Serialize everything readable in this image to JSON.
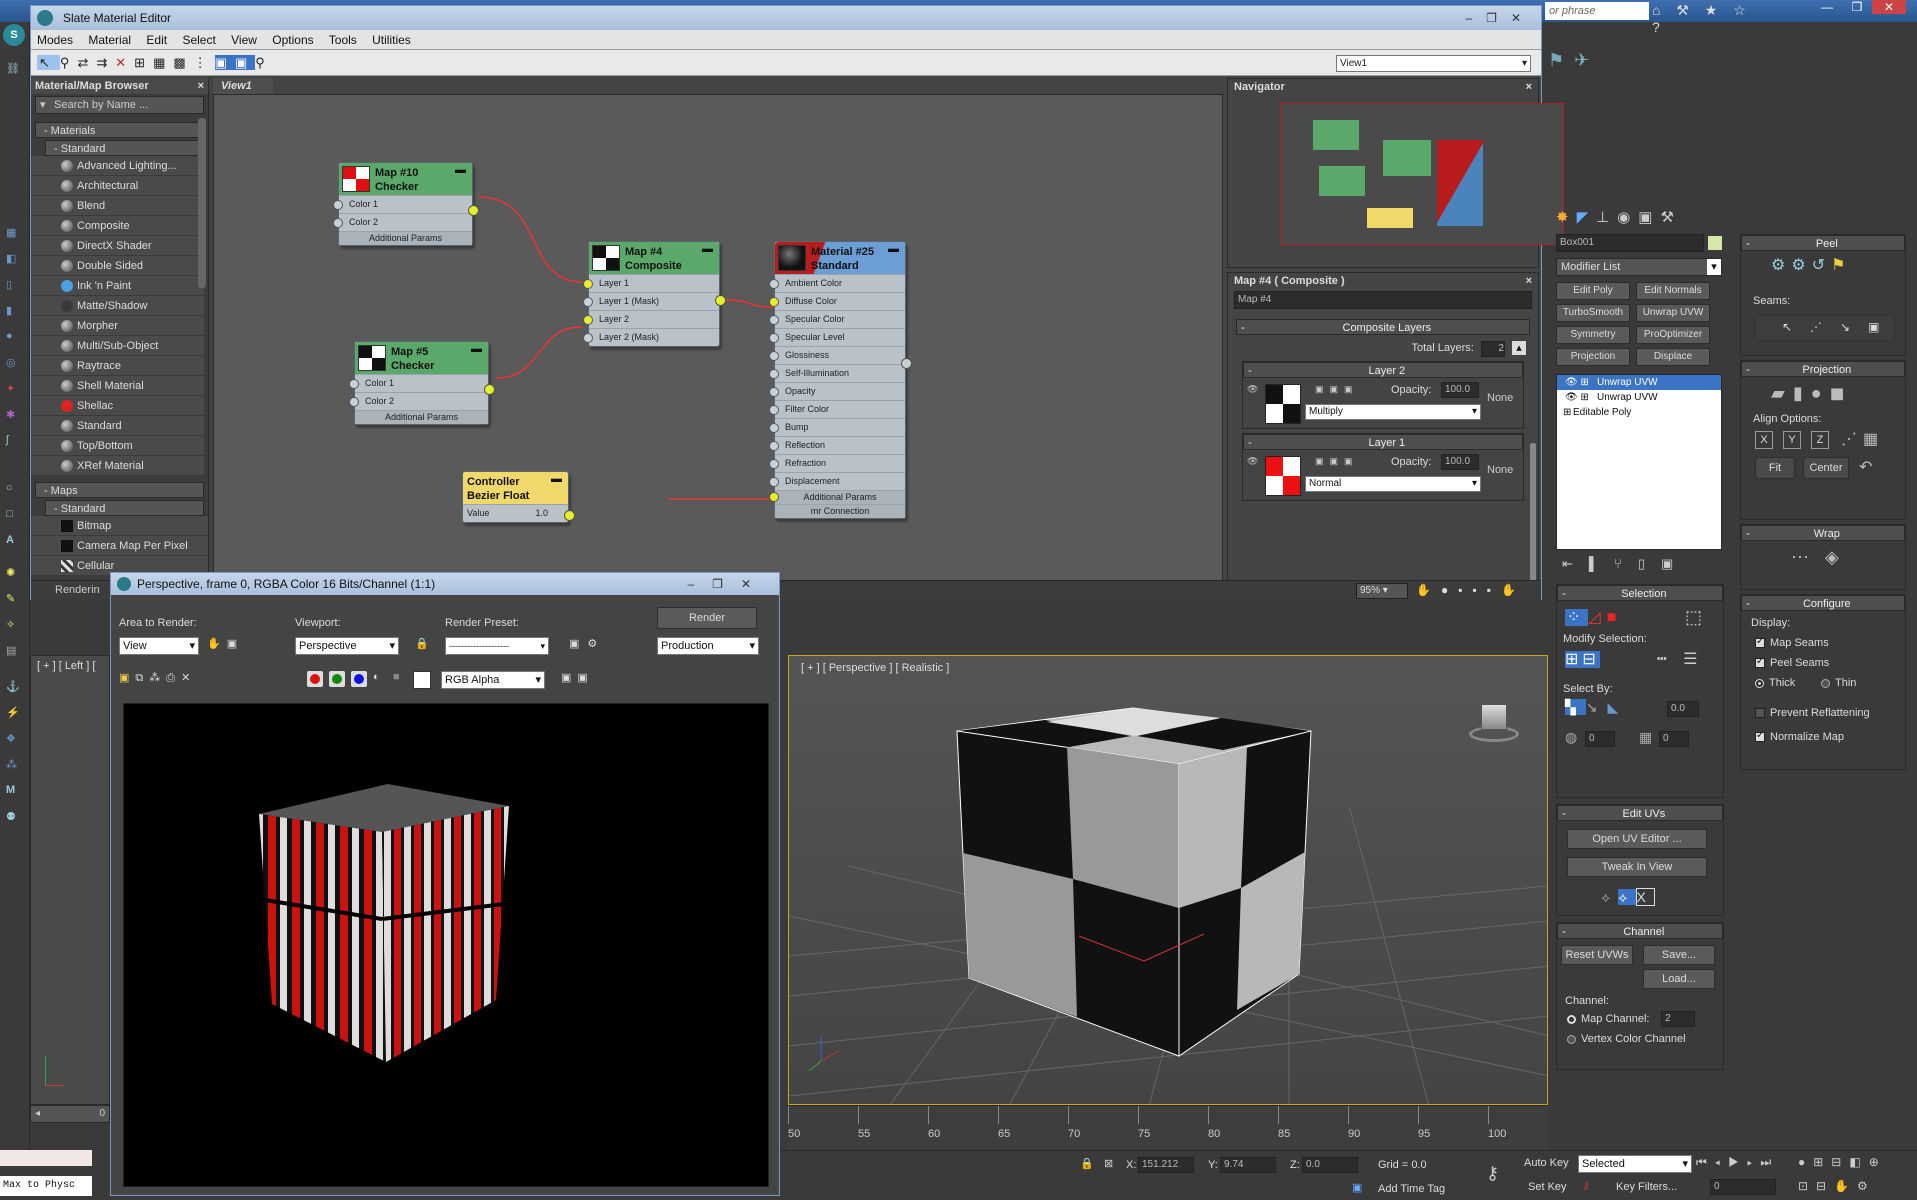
{
  "app": {
    "slate_title": "Slate Material Editor",
    "search_top_placeholder": "or phrase"
  },
  "slate_menu": [
    "Modes",
    "Material",
    "Edit",
    "Select",
    "View",
    "Options",
    "Tools",
    "Utilities"
  ],
  "view_dropdown": "View1",
  "browser": {
    "title": "Material/Map Browser",
    "search_placeholder": "Search by Name ...",
    "materials_label": "Materials",
    "standard_label": "Standard",
    "materials": [
      "Advanced Lighting...",
      "Architectural",
      "Blend",
      "Composite",
      "DirectX Shader",
      "Double Sided",
      "Ink 'n Paint",
      "Matte/Shadow",
      "Morpher",
      "Multi/Sub-Object",
      "Raytrace",
      "Shell Material",
      "Shellac",
      "Standard",
      "Top/Bottom",
      "XRef Material"
    ],
    "maps_label": "Maps",
    "maps_standard_label": "Standard",
    "maps": [
      "Bitmap",
      "Camera Map Per Pixel",
      "Cellular"
    ]
  },
  "view_tab": "View1",
  "nodes": {
    "map10": {
      "line1": "Map #10",
      "line2": "Checker",
      "slots": [
        "Color 1",
        "Color 2"
      ],
      "addp": "Additional Params"
    },
    "map5": {
      "line1": "Map #5",
      "line2": "Checker",
      "slots": [
        "Color 1",
        "Color 2"
      ],
      "addp": "Additional Params"
    },
    "map4": {
      "line1": "Map #4",
      "line2": "Composite",
      "slots": [
        "Layer 1",
        "Layer 1 (Mask)",
        "Layer 2",
        "Layer 2 (Mask)"
      ]
    },
    "mat25": {
      "line1": "Material #25",
      "line2": "Standard",
      "slots": [
        "Ambient Color",
        "Diffuse Color",
        "Specular Color",
        "Specular Level",
        "Glossiness",
        "Self-Illumination",
        "Opacity",
        "Filter Color",
        "Bump",
        "Reflection",
        "Refraction",
        "Displacement"
      ],
      "addp": "Additional Params",
      "mr": "mr Connection"
    },
    "ctrl": {
      "line1": "Controller",
      "line2": "Bezier Float",
      "slot": "Value",
      "value": "1.0"
    }
  },
  "navigator": {
    "title": "Navigator"
  },
  "composite_panel": {
    "title": "Map #4  ( Composite )",
    "name_field": "Map #4",
    "rollout": "Composite Layers",
    "total_layers_label": "Total Layers:",
    "total_layers": "2",
    "layer2": {
      "title": "Layer 2",
      "opacity_label": "Opacity:",
      "opacity": "100.0",
      "mode": "Multiply",
      "none": "None"
    },
    "layer1": {
      "title": "Layer 1",
      "opacity_label": "Opacity:",
      "opacity": "100.0",
      "mode": "Normal",
      "none": "None"
    }
  },
  "zoom": "95%",
  "render_window": {
    "title": "Perspective, frame 0, RGBA Color 16 Bits/Channel (1:1)",
    "area_label": "Area to Render:",
    "area_value": "View",
    "viewport_label": "Viewport:",
    "viewport_value": "Perspective",
    "preset_label": "Render Preset:",
    "preset_value": "--------------------",
    "render_button": "Render",
    "production": "Production",
    "channel": "RGB Alpha"
  },
  "left_viewport_label": "[ + ] [ Left ] [",
  "persp_label": "[ + ] [ Perspective ] [ Realistic ]",
  "timeline": [
    "50",
    "55",
    "60",
    "65",
    "70",
    "75",
    "80",
    "85",
    "90",
    "95",
    "100"
  ],
  "status": {
    "x_label": "X:",
    "x": "151.212",
    "y_label": "Y:",
    "y": "9.74",
    "z_label": "Z:",
    "z": "0.0",
    "grid": "Grid = 0.0",
    "add_time_tag": "Add Time Tag",
    "auto_key": "Auto Key",
    "selected": "Selected",
    "set_key": "Set Key",
    "key_filters": "Key Filters...",
    "frame": "0",
    "script": "Max to Physc",
    "rendering": "Renderin"
  },
  "modify": {
    "object_name": "Box001",
    "modifier_list": "Modifier List",
    "buttons": [
      "Edit Poly",
      "Edit Normals",
      "TurboSmooth",
      "Unwrap UVW",
      "Symmetry",
      "ProOptimizer",
      "Projection",
      "Displace"
    ],
    "stack": [
      "Unwrap UVW",
      "Unwrap UVW",
      "Editable Poly"
    ],
    "selection_title": "Selection",
    "modify_selection": "Modify Selection:",
    "select_by": "Select By:",
    "spin1": "0.0",
    "spin2": "0",
    "spin3": "0",
    "edit_uvs_title": "Edit UVs",
    "open_uv_editor": "Open UV Editor ...",
    "tweak_in_view": "Tweak In View",
    "channel_title": "Channel",
    "reset_uvws": "Reset UVWs",
    "save": "Save...",
    "load": "Load...",
    "channel_label": "Channel:",
    "map_channel_label": "Map Channel:",
    "map_channel_value": "2",
    "vertex_color_channel": "Vertex Color Channel"
  },
  "right_col": {
    "peel_title": "Peel",
    "seams_label": "Seams:",
    "projection_title": "Projection",
    "align_options": "Align Options:",
    "x": "X",
    "y": "Y",
    "z": "Z",
    "fit": "Fit",
    "center": "Center",
    "wrap_title": "Wrap",
    "configure_title": "Configure",
    "display_label": "Display:",
    "map_seams": "Map Seams",
    "peel_seams": "Peel Seams",
    "thick": "Thick",
    "thin": "Thin",
    "prevent_reflattening": "Prevent Reflattening",
    "normalize_map": "Normalize Map"
  }
}
